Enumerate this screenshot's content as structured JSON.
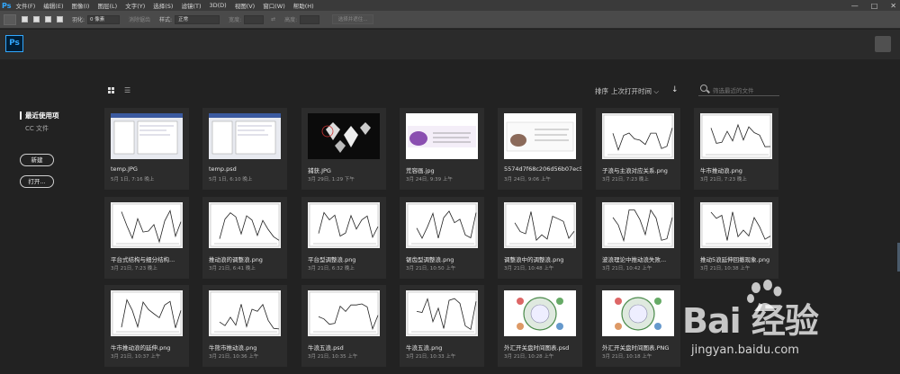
{
  "menubar": {
    "logo": "Ps",
    "items": [
      "文件(F)",
      "编辑(E)",
      "图像(I)",
      "图层(L)",
      "文字(Y)",
      "选择(S)",
      "滤镜(T)",
      "3D(D)",
      "视图(V)",
      "窗口(W)",
      "帮助(H)"
    ],
    "window_controls": [
      "—",
      "□",
      "✕"
    ]
  },
  "optionsbar": {
    "feather_label": "羽化:",
    "feather_value": "0 像素",
    "antialias_label": "消除锯齿",
    "style_label": "样式:",
    "style_value": "正常",
    "width_label": "宽度:",
    "height_label": "高度:",
    "select_mask_label": "选择并遮住..."
  },
  "app": {
    "logo": "Ps",
    "nav": {
      "recent": "最近使用项",
      "cc_files": "CC 文件"
    },
    "new_button": "新建",
    "open_button": "打开..."
  },
  "toolbar": {
    "sort_label": "排序",
    "sort_value": "上次打开时间  ⌵",
    "sort_direction_icon": "↓",
    "search_placeholder": "筛选最近的文件"
  },
  "files": [
    {
      "name": "temp.JPG",
      "date": "5月 1日, 7:16 晚上",
      "thumb": "screenshot"
    },
    {
      "name": "temp.psd",
      "date": "5月 1日, 6:10 晚上",
      "thumb": "screenshot"
    },
    {
      "name": "捕获.JPG",
      "date": "3月 29日, 1:29 下午",
      "thumb": "diamonds"
    },
    {
      "name": "荒容画.jpg",
      "date": "3月 24日, 9:39 上午",
      "thumb": "purple"
    },
    {
      "name": "5574d7f68c206d56b07ec5...",
      "date": "3月 24日, 9:06 上午",
      "thumb": "coffee"
    },
    {
      "name": "子浪与主浪对应关系.png",
      "date": "3月 21日, 7:23 晚上",
      "thumb": "chart"
    },
    {
      "name": "牛市推动浪.png",
      "date": "3月 21日, 7:23 晚上",
      "thumb": "chart"
    },
    {
      "name": "平台式结构与细分结构...",
      "date": "3月 21日, 7:23 晚上",
      "thumb": "chart"
    },
    {
      "name": "推动浪的调整浪.png",
      "date": "3月 21日, 6:41 晚上",
      "thumb": "chart"
    },
    {
      "name": "平台型调整浪.png",
      "date": "3月 21日, 6:32 晚上",
      "thumb": "chart"
    },
    {
      "name": "锯齿型调整浪.png",
      "date": "3月 21日, 10:50 上午",
      "thumb": "chart"
    },
    {
      "name": "调整浪中的调整浪.png",
      "date": "3月 21日, 10:48 上午",
      "thumb": "chart"
    },
    {
      "name": "波浪理论中推动浪失败...",
      "date": "3月 21日, 10:42 上午",
      "thumb": "chart"
    },
    {
      "name": "推动5浪延伸回撤现象.png",
      "date": "3月 21日, 10:38 上午",
      "thumb": "chart"
    },
    {
      "name": "牛市推动浪的延伸.png",
      "date": "3月 21日, 10:37 上午",
      "thumb": "chart"
    },
    {
      "name": "牛熊市推动浪.png",
      "date": "3月 21日, 10:36 上午",
      "thumb": "chart"
    },
    {
      "name": "牛浪五浪.psd",
      "date": "3月 21日, 10:35 上午",
      "thumb": "chart"
    },
    {
      "name": "牛浪五浪.png",
      "date": "3月 21日, 10:33 上午",
      "thumb": "chart"
    },
    {
      "name": "外汇开关盘时间图表.psd",
      "date": "3月 21日, 10:28 上午",
      "thumb": "clock"
    },
    {
      "name": "外汇开关盘时间图表.PNG",
      "date": "3月 21日, 10:18 上午",
      "thumb": "clock"
    }
  ],
  "watermark": {
    "logo": "Bai 经验",
    "url": "jingyan.baidu.com"
  }
}
